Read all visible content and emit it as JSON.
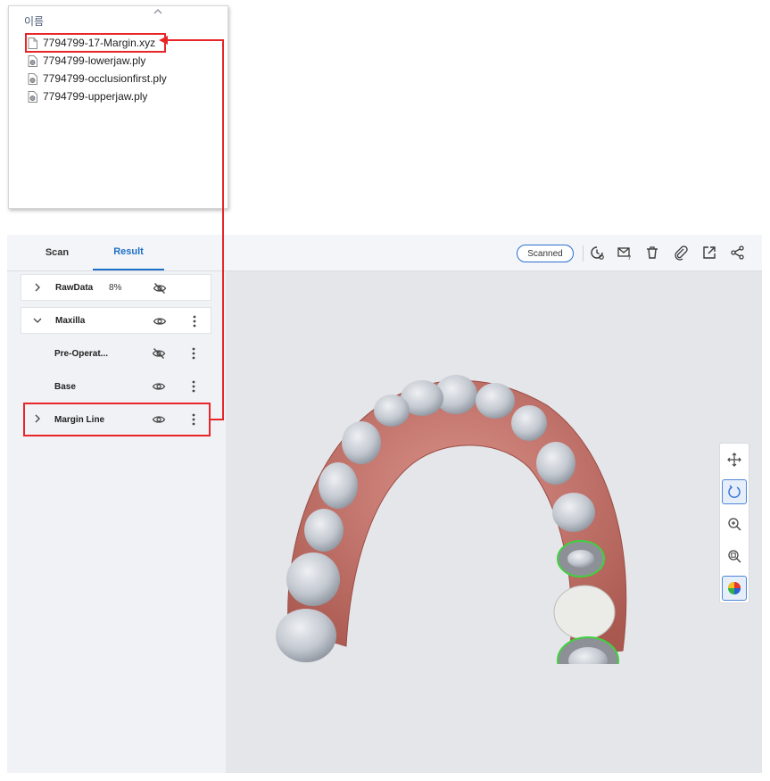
{
  "explorer": {
    "column_header": "이름",
    "files": [
      {
        "name": "7794799-17-Margin.xyz",
        "icon": "document-icon",
        "highlighted": true
      },
      {
        "name": "7794799-lowerjaw.ply",
        "icon": "ply-file-icon",
        "highlighted": false
      },
      {
        "name": "7794799-occlusionfirst.ply",
        "icon": "ply-file-icon",
        "highlighted": false
      },
      {
        "name": "7794799-upperjaw.ply",
        "icon": "ply-file-icon",
        "highlighted": false
      }
    ]
  },
  "app": {
    "tabs": [
      {
        "label": "Scan",
        "active": false
      },
      {
        "label": "Result",
        "active": true
      }
    ],
    "toolbar": {
      "scanned_label": "Scanned",
      "icons": [
        "history-icon",
        "mail-help-icon",
        "trash-icon",
        "attach-icon",
        "export-icon",
        "share-icon"
      ]
    },
    "tree": [
      {
        "label": "RawData",
        "percent": "8%",
        "expandable": true,
        "expanded": false,
        "visible": false,
        "menu": false
      },
      {
        "label": "Maxilla",
        "expandable": true,
        "expanded": true,
        "visible": true,
        "menu": true
      },
      {
        "label": "Pre-Operat...",
        "expandable": false,
        "visible": false,
        "menu": true
      },
      {
        "label": "Base",
        "expandable": false,
        "visible": true,
        "menu": true
      },
      {
        "label": "Margin Line",
        "expandable": true,
        "expanded": false,
        "visible": true,
        "menu": true,
        "highlighted": true
      }
    ],
    "view_tools": [
      "move-icon",
      "rotate-icon",
      "zoom-in-icon",
      "zoom-fit-icon",
      "color-map-icon"
    ],
    "active_view_tools": [
      "rotate-icon",
      "color-map-icon"
    ]
  },
  "colors": {
    "accent": "#1f6fc7",
    "highlight": "#e8262a",
    "gingiva": "#c97a72",
    "tooth": "#c9ced6",
    "margin_line": "#3fd23f"
  }
}
